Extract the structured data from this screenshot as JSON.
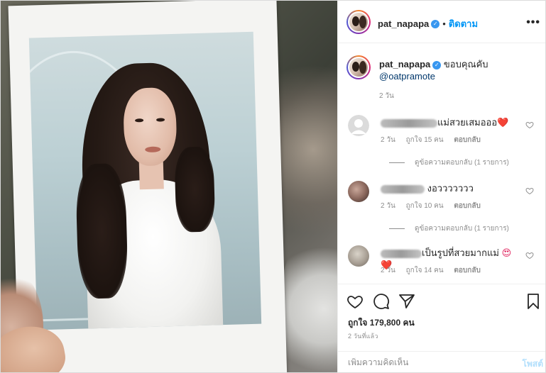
{
  "post": {
    "owner": "pat_napapa",
    "follow_label": "ติดตาม",
    "separator": "•",
    "more_label": "•••"
  },
  "caption": {
    "username": "pat_napapa",
    "text": "ขอบคุณคับ",
    "mention": "@oatpramote",
    "time": "2 วัน"
  },
  "comments": [
    {
      "text": "แม่สวยเสมอออ",
      "emoji": "❤️",
      "time": "2 วัน",
      "likes": "ถูกใจ 15 คน",
      "reply": "ตอบกลับ",
      "view_replies": "ดูข้อความตอบกลับ (1 รายการ)"
    },
    {
      "text": "งอววววววว",
      "emoji": "",
      "time": "2 วัน",
      "likes": "ถูกใจ 10 คน",
      "reply": "ตอบกลับ",
      "view_replies": "ดูข้อความตอบกลับ (1 รายการ)"
    },
    {
      "text": "เป็นรูปที่สวยมากแม่",
      "emoji": "😍❤️",
      "time": "2 วัน",
      "likes": "ถูกใจ 14 คน",
      "reply": "ตอบกลับ"
    }
  ],
  "actions": {
    "like_count": "ถูกใจ 179,800 คน",
    "post_time": "2 วันที่แล้ว"
  },
  "comment_box": {
    "placeholder": "เพิ่มความคิดเห็น",
    "post_label": "โพสต์"
  },
  "colors": {
    "link": "#0095f6",
    "mention": "#00376b",
    "verified": "#3897f0",
    "muted": "#8e8e8e",
    "post_disabled": "#b2dffc"
  }
}
